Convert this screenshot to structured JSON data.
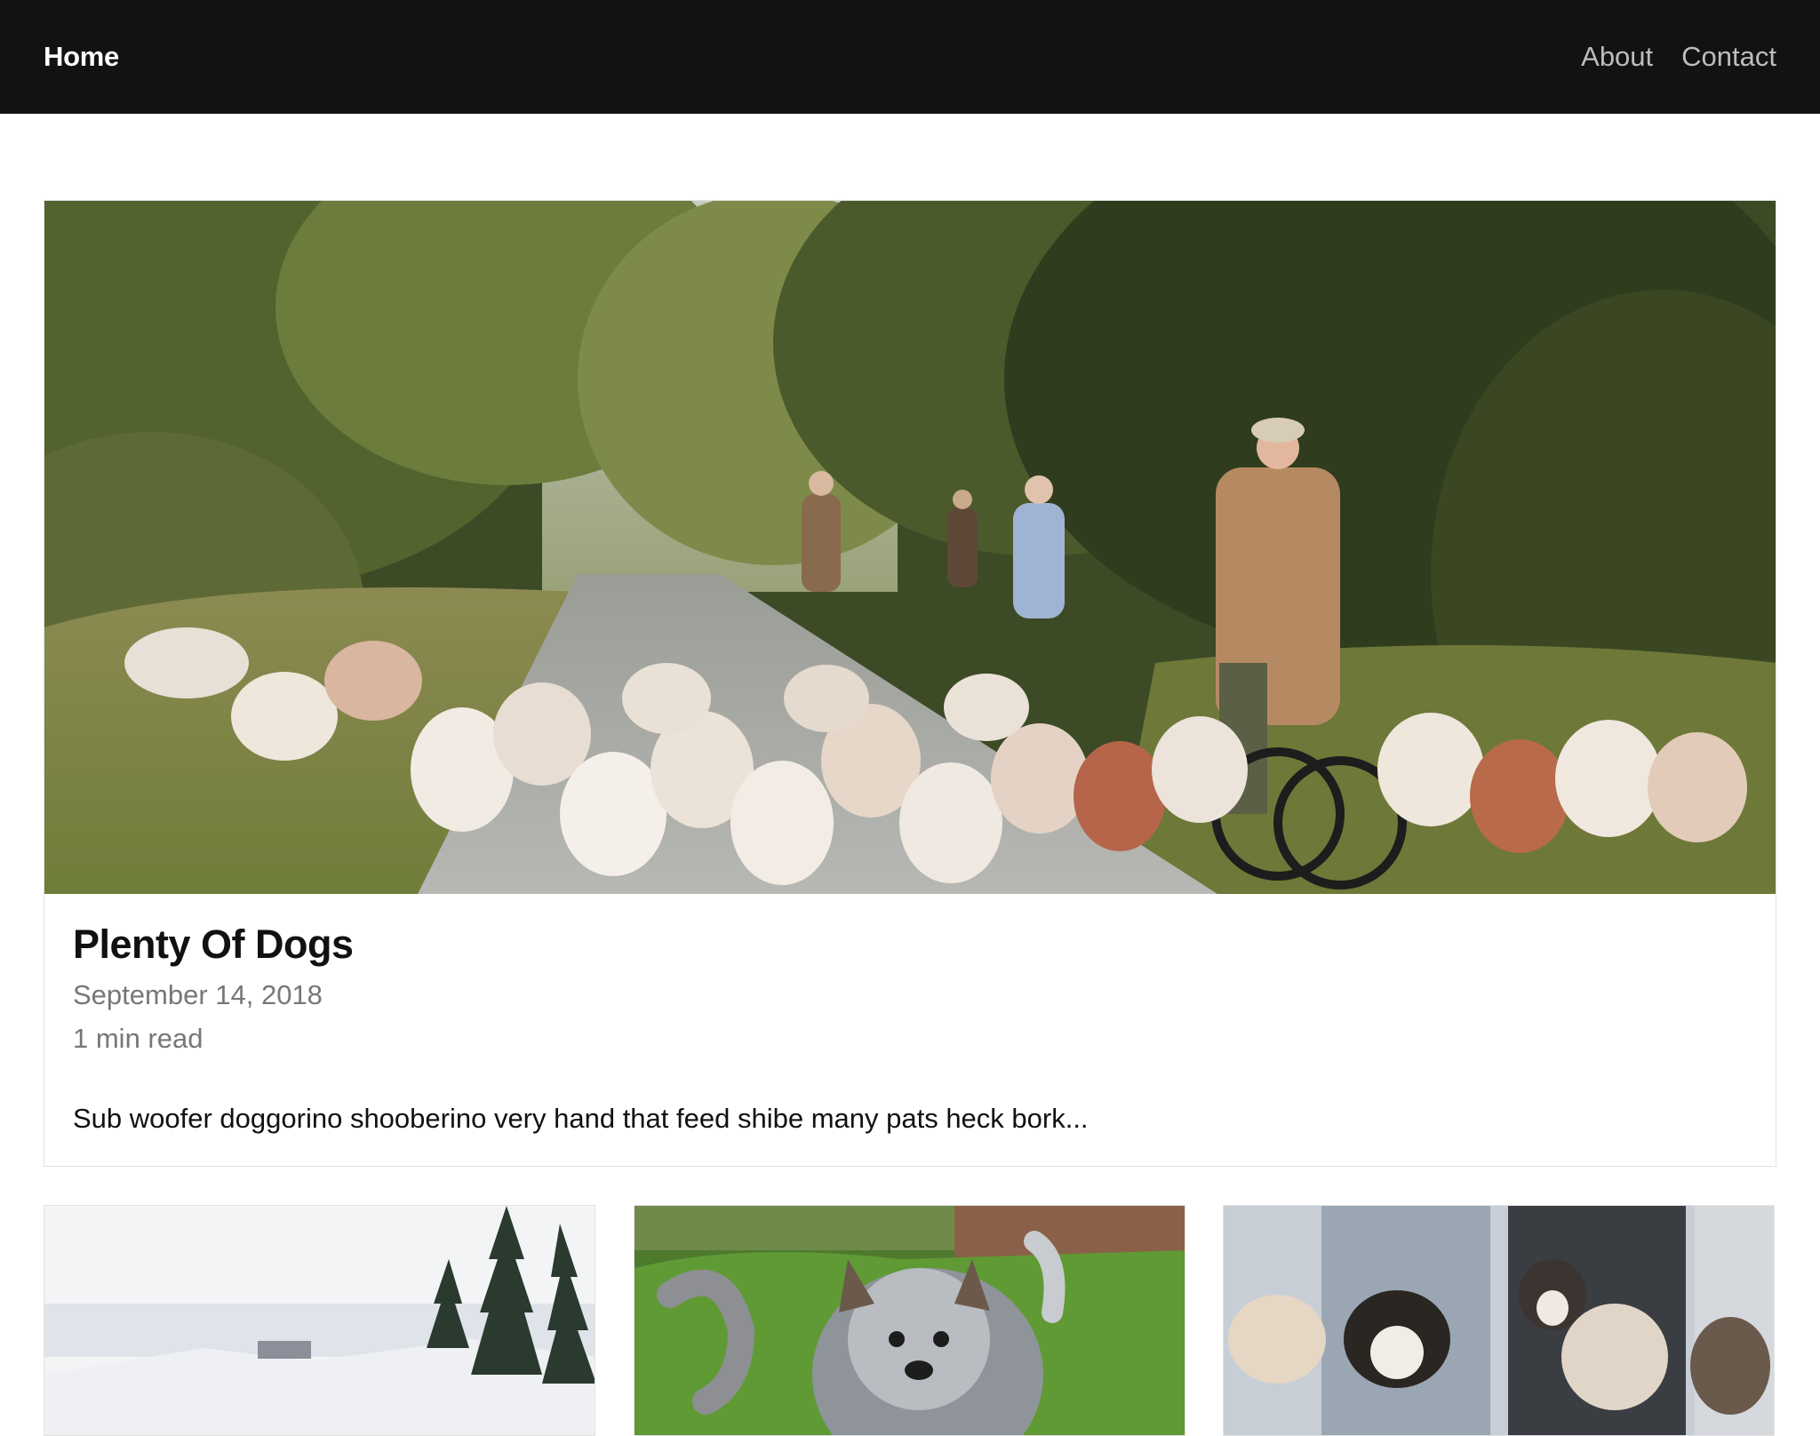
{
  "nav": {
    "home_label": "Home",
    "links": [
      {
        "label": "About"
      },
      {
        "label": "Contact"
      }
    ]
  },
  "featured_post": {
    "title": "Plenty Of Dogs",
    "date": "September 14, 2018",
    "read_time": "1 min read",
    "excerpt": "Sub woofer doggorino shooberino very hand that feed shibe many pats heck bork..."
  },
  "colors": {
    "navbar_bg": "#121212",
    "nav_home": "#ffffff",
    "nav_link": "#bdbdbd",
    "meta_text": "#777777",
    "card_border": "#e3e3e3"
  }
}
